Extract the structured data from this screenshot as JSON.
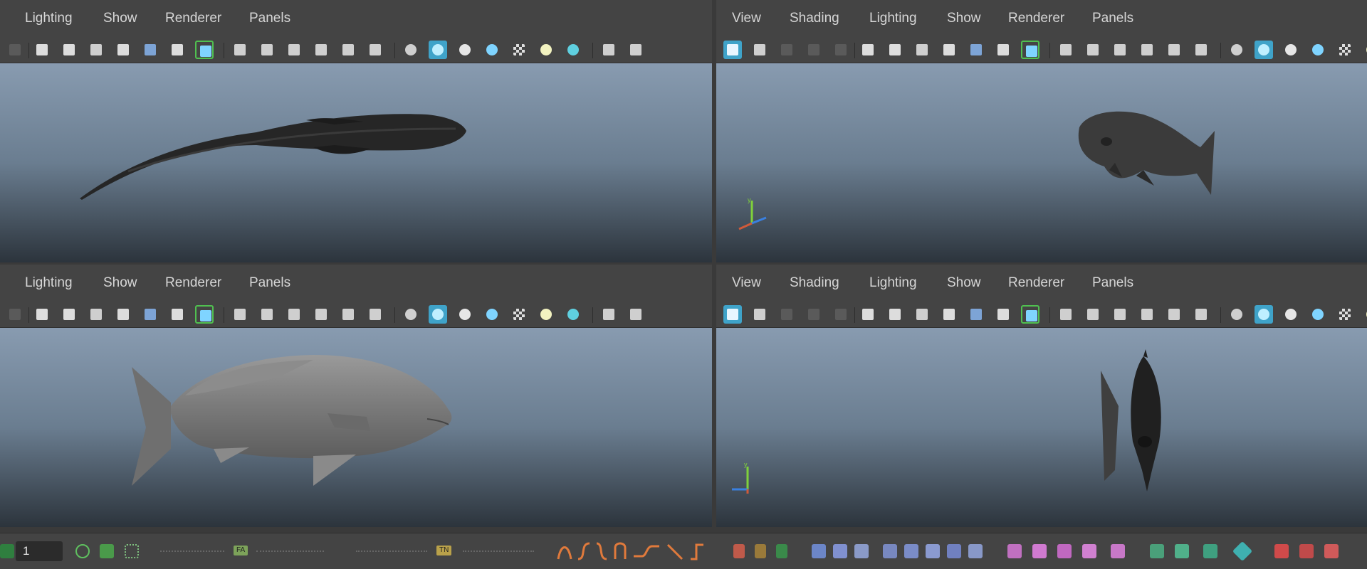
{
  "viewport_panels": [
    {
      "id": "top-left",
      "menus": [
        "Lighting",
        "Show",
        "Renderer",
        "Panels"
      ]
    },
    {
      "id": "top-right",
      "menus": [
        "View",
        "Shading",
        "Lighting",
        "Show",
        "Renderer",
        "Panels"
      ]
    },
    {
      "id": "bottom-left",
      "menus": [
        "Lighting",
        "Show",
        "Renderer",
        "Panels"
      ]
    },
    {
      "id": "bottom-right",
      "menus": [
        "View",
        "Shading",
        "Lighting",
        "Show",
        "Renderer",
        "Panels"
      ]
    }
  ],
  "toolbar_icons": [
    "camera-icon",
    "video-camera-icon",
    "film-gate-icon",
    "bookmark-icon",
    "image-plane-icon",
    "pivot-icon",
    "pencil-icon",
    "grid-icon",
    "resolution-gate-icon",
    "safe-area-icon",
    "field-chart-icon",
    "image-icon",
    "text-icon",
    "wireframe-cube-icon",
    "shaded-cube-icon",
    "smooth-icon",
    "textured-cube-icon",
    "checker-icon",
    "light-bulb-icon",
    "shadow-icon",
    "ambient-occlusion-icon",
    "motion-blur-icon"
  ],
  "bottom_bar": {
    "frame_value": "1",
    "keyframe_chips": [
      "FA",
      "TN"
    ]
  },
  "colors": {
    "panel_bg": "#444444",
    "viewport_top": "#889bb0",
    "viewport_bottom": "#2c343c",
    "active_icon": "#3fa3c9",
    "accent_green": "#50c050",
    "curve_orange": "#e07a3c"
  }
}
